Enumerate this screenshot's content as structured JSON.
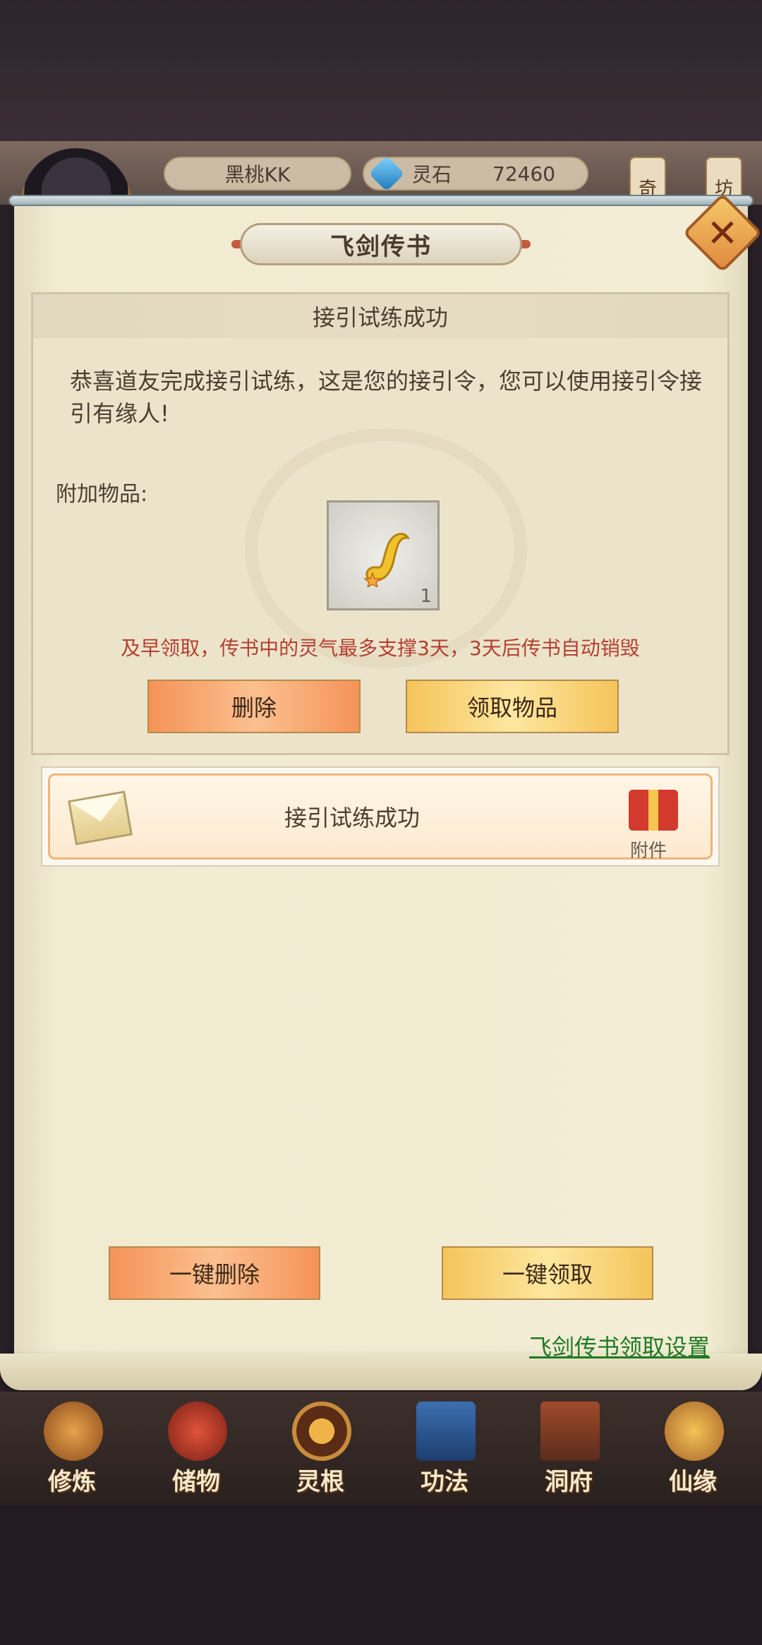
{
  "header": {
    "player_name": "黑桃KK",
    "currency_label": "灵石",
    "currency_value": "72460",
    "side_tabs": [
      "奇",
      "坊"
    ]
  },
  "dialog": {
    "title": "飞剑传书",
    "close_icon": "close-icon"
  },
  "mail_detail": {
    "subject": "接引试练成功",
    "body": "恭喜道友完成接引试练，这是您的接引令，您可以使用接引令接引有缘人!",
    "attachments_label": "附加物品:",
    "attachment_item_icon": "scroll-token-icon",
    "attachment_count": "1",
    "warning": "及早领取，传书中的灵气最多支撑3天，3天后传书自动销毁",
    "delete_label": "删除",
    "claim_label": "领取物品"
  },
  "mail_list": [
    {
      "subject": "接引试练成功",
      "icon": "envelope-icon",
      "attachment_label": "附件"
    }
  ],
  "footer": {
    "delete_all_label": "一键删除",
    "claim_all_label": "一键领取",
    "settings_link": "飞剑传书领取设置"
  },
  "bottom_nav": [
    {
      "label": "修炼",
      "icon": "cultivation-icon"
    },
    {
      "label": "储物",
      "icon": "storage-bag-icon"
    },
    {
      "label": "灵根",
      "icon": "spirit-root-icon"
    },
    {
      "label": "功法",
      "icon": "technique-book-icon"
    },
    {
      "label": "洞府",
      "icon": "cave-dwelling-icon"
    },
    {
      "label": "仙缘",
      "icon": "fate-icon"
    }
  ],
  "colors": {
    "warning_text": "#b43f30",
    "link_text": "#1f7a24",
    "paper": "#f2edd4"
  }
}
